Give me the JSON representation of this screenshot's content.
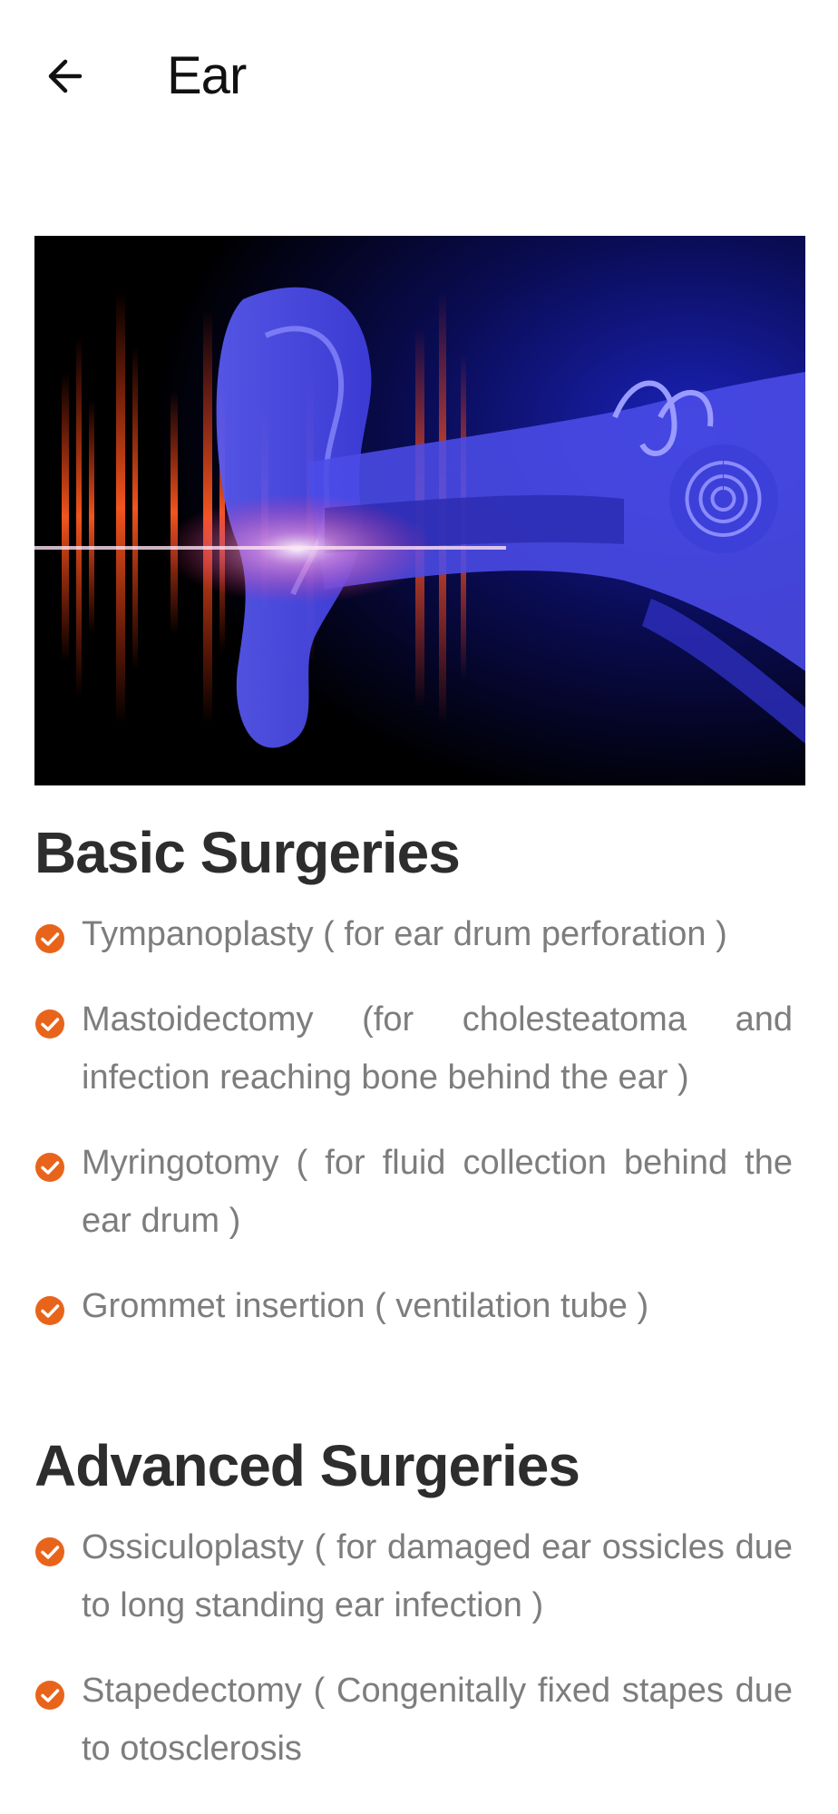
{
  "header": {
    "back_icon": "arrow-left-icon",
    "title": "Ear"
  },
  "hero": {
    "icon": "ear-anatomy-illustration",
    "colors": {
      "background": "#000000",
      "ear": "#4f4ff0",
      "sound_wave": "#ff4a1c"
    }
  },
  "sections": [
    {
      "title": "Basic Surgeries",
      "items": [
        "Tympanoplasty ( for ear drum perforation )",
        "Mastoidectomy (for cholesteatoma and infection reaching bone behind the ear )",
        "Myringotomy ( for fluid collection behind the ear drum )",
        "Grommet insertion ( ventilation tube )"
      ]
    },
    {
      "title": "Advanced Surgeries",
      "items": [
        "Ossiculoplasty ( for damaged ear ossicles due to long standing ear infection )",
        "Stapedectomy ( Congenitally fixed stapes due to otosclerosis"
      ]
    }
  ],
  "accent_color": "#e8641b"
}
